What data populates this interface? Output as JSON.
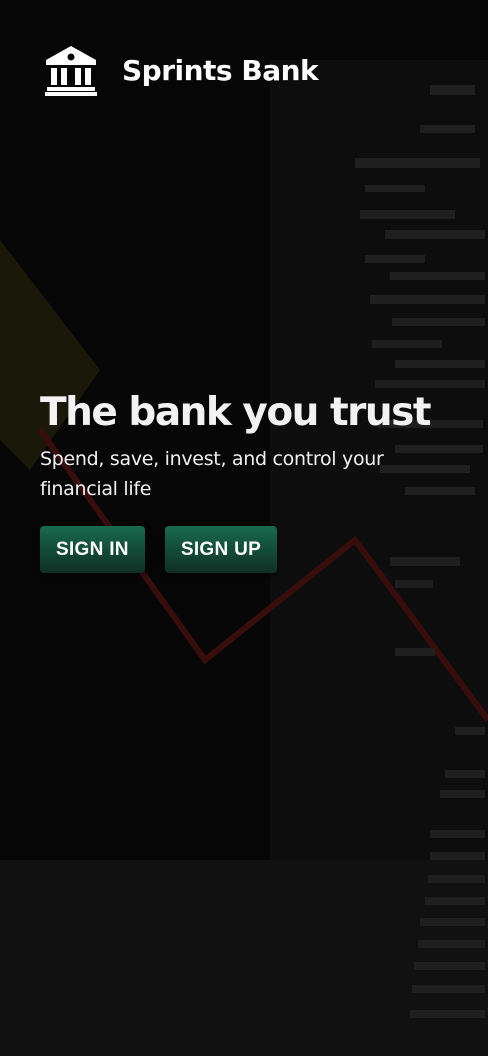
{
  "brand": {
    "name": "Sprints Bank",
    "logo_icon": "bank-icon"
  },
  "hero": {
    "title": "The bank you trust",
    "subtitle": "Spend, save, invest, and control your financial life"
  },
  "actions": {
    "sign_in_label": "SIGN IN",
    "sign_up_label": "SIGN UP"
  },
  "colors": {
    "button": "#1a5c45",
    "background": "#070707",
    "text": "#ffffff"
  }
}
